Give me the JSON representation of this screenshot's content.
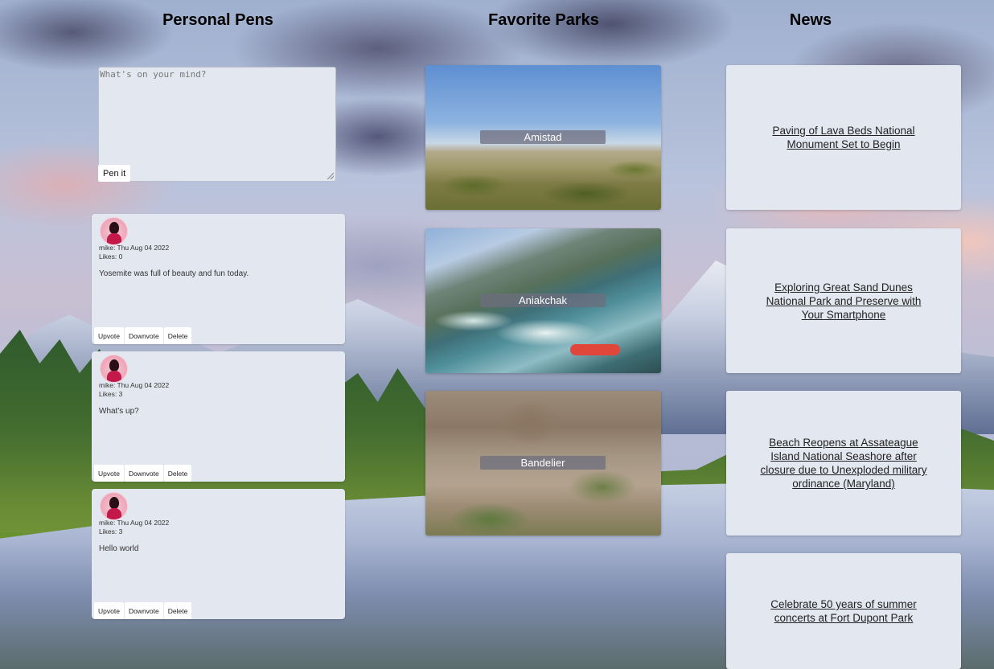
{
  "columns": {
    "pens_title": "Personal Pens",
    "parks_title": "Favorite Parks",
    "news_title": "News"
  },
  "composer": {
    "placeholder": "What's on your mind?",
    "submit_label": "Pen it"
  },
  "posts": [
    {
      "author_line": "mike: Thu Aug 04 2022",
      "likes": "Likes: 0",
      "body": "Yosemite was full of beauty and fun today."
    },
    {
      "author_line": "mike: Thu Aug 04 2022",
      "likes": "Likes: 3",
      "body": "What's up?"
    },
    {
      "author_line": "mike: Thu Aug 04 2022",
      "likes": "Likes: 3",
      "body": "Hello world"
    }
  ],
  "post_actions": {
    "upvote": "Upvote",
    "downvote": "Downvote",
    "delete": "Delete"
  },
  "parks": [
    {
      "name": "Amistad"
    },
    {
      "name": "Aniakchak"
    },
    {
      "name": "Bandelier"
    }
  ],
  "news": [
    {
      "title": "Paving of Lava Beds National Monument Set to Begin"
    },
    {
      "title": "Exploring Great Sand Dunes National Park and Preserve with Your Smartphone"
    },
    {
      "title": "Beach Reopens at Assateague Island National Seashore after closure due to Unexploded military ordinance (Maryland)"
    },
    {
      "title": "Celebrate 50 years of summer concerts at Fort Dupont Park"
    }
  ]
}
